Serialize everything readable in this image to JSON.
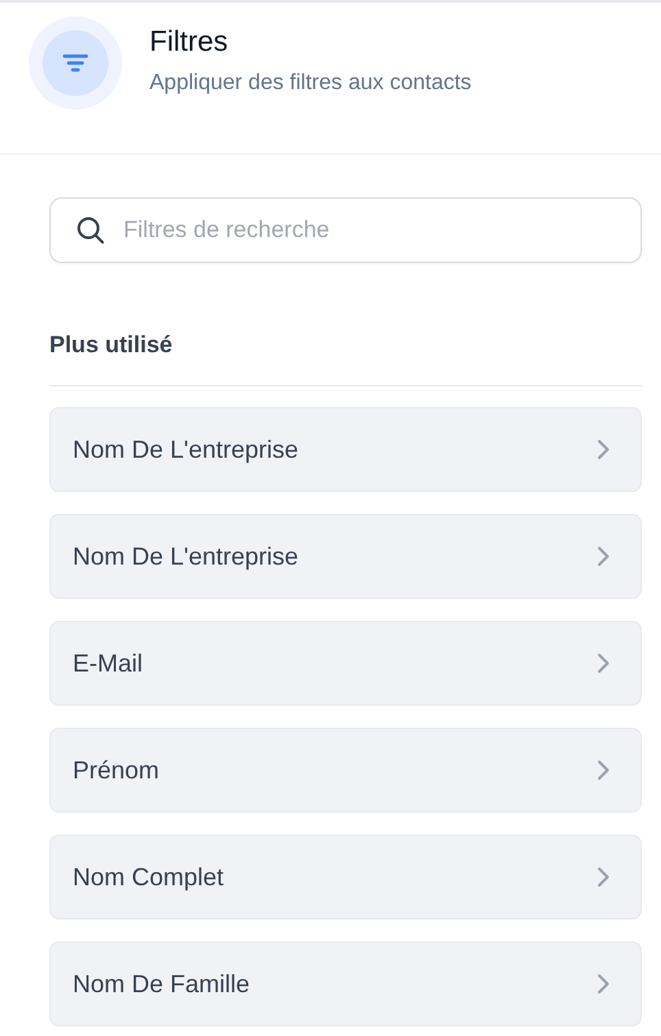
{
  "header": {
    "title": "Filtres",
    "subtitle": "Appliquer des filtres aux contacts"
  },
  "search": {
    "placeholder": "Filtres de recherche"
  },
  "section": {
    "title": "Plus utilisé"
  },
  "filters": [
    {
      "label": "Nom De L'entreprise"
    },
    {
      "label": "Nom De L'entreprise"
    },
    {
      "label": "E-Mail"
    },
    {
      "label": "Prénom"
    },
    {
      "label": "Nom Complet"
    },
    {
      "label": "Nom De Famille"
    }
  ]
}
